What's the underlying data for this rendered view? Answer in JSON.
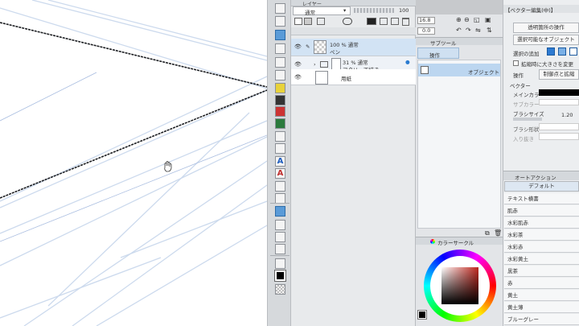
{
  "layer_panel": {
    "header": "レイヤー",
    "blend_mode": "通常",
    "opacity": "100",
    "layers": [
      {
        "opacity_mode": "100 % 通常",
        "name": "ペン",
        "selected": true
      },
      {
        "opacity_mode": "31 % 通常",
        "name": "アタリ・下描き",
        "selected": false
      },
      {
        "opacity_mode": "",
        "name": "用紙",
        "selected": false
      }
    ]
  },
  "navigator": {
    "zoom": "16.8",
    "rotation": "0.0"
  },
  "sub_tool": {
    "header": "サブツール",
    "tab": "操作",
    "item": "オブジェクト"
  },
  "color_circle": {
    "header": "カラーサークル",
    "accent_red": "#c0281f",
    "ring_colors": [
      "#ff0000",
      "#ffff00",
      "#00ff00",
      "#00ffff",
      "#0000ff",
      "#ff00ff",
      "#ff0000"
    ]
  },
  "tool_property": {
    "title": "【ベクター編集(中)】",
    "transparent_op": "透明箇所の操作",
    "selectable_obj": "選択可能なオブジェクト",
    "add_selection": "選択の追加",
    "scale_checkbox": "拡縮時に大きさを変更",
    "operation_label": "操作",
    "operation_value": "制御点と拡縮",
    "vector_label": "ベクター",
    "main_color_label": "メインカラー",
    "sub_color_label": "サブカラー",
    "brush_size_label": "ブラシサイズ",
    "brush_size_value": "1.20",
    "brush_shape_label": "ブラシ形状",
    "in_out_label": "入り抜き"
  },
  "auto_action": {
    "header": "オートアクション",
    "default": "デフォルト",
    "items": [
      "テキスト横書",
      "肌赤",
      "水彩肌赤",
      "水彩茶",
      "水彩赤",
      "水彩黄土",
      "黒茶",
      "赤",
      "黄土",
      "黄土薄",
      "ブルーグレー"
    ]
  }
}
